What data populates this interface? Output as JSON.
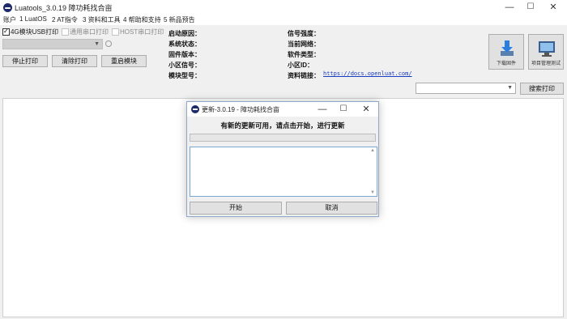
{
  "window": {
    "title": "Luatools_3.0.19 障功耗找合亩",
    "controls": [
      "—",
      "☐",
      "✕"
    ]
  },
  "menu": [
    "账户",
    "1 LuatOS",
    "2 AT指令",
    "3 资料和工具",
    "4 帮助和支持",
    "5 新品预告"
  ],
  "print_options": [
    {
      "label": "4G模块USB打印",
      "checked": true,
      "enabled": true
    },
    {
      "label": "通用串口打印",
      "checked": false,
      "enabled": false
    },
    {
      "label": "HOST串口打印",
      "checked": false,
      "enabled": false
    }
  ],
  "buttons": {
    "stop_print": "停止打印",
    "clear_print": "清除打印",
    "restart_module": "重启模块",
    "search_print": "搜索打印",
    "download_firmware": "下载固件",
    "project_test": "项目管理测试"
  },
  "info_left": [
    "启动原因：",
    "系统状态：",
    "固件版本：",
    "小区信号：",
    "模块型号："
  ],
  "info_right": [
    "信号强度：",
    "当前网络：",
    "软件类型：",
    "小区ID：",
    "资料链接："
  ],
  "doc_link": "https://docs.openluat.com/",
  "dialog": {
    "title": "更新-3.0.19 - 障功耗找合亩",
    "message": "有新的更新可用，请点击开始，进行更新",
    "start_button": "开始",
    "cancel_button": "取消",
    "controls": [
      "—",
      "☐",
      "✕"
    ]
  },
  "colors": {
    "link": "#1a3cbe",
    "dialog_border": "#8fa8c8",
    "text_box_border": "#7aa6d6"
  }
}
